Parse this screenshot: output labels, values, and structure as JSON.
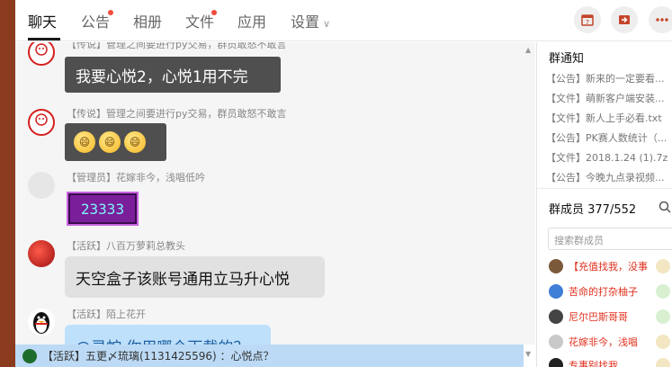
{
  "tabs": [
    {
      "label": "聊天",
      "active": true
    },
    {
      "label": "公告",
      "dot": true
    },
    {
      "label": "相册"
    },
    {
      "label": "文件",
      "dot": true
    },
    {
      "label": "应用"
    },
    {
      "label": "设置"
    }
  ],
  "top_icons": [
    "calendar-icon",
    "forward-icon",
    "more-icon"
  ],
  "messages": [
    {
      "sender": "【传说】管理之间要进行py交易，群员敢怒不敢言",
      "text": "我要心悦2，心悦1用不完"
    },
    {
      "sender": "【传说】管理之间要进行py交易，群员敢怒不敢言",
      "emojis": [
        "😄",
        "😄",
        "😄"
      ]
    },
    {
      "sender": "【管理员】花嫁非今，浅唱低吟",
      "text": "23333"
    },
    {
      "sender": "【活跃】八百万萝莉总教头",
      "text": "天空盒子该账号通用立马升心悦"
    },
    {
      "sender": "【活跃】陌上花开",
      "text": "@灵蛇  你用哪个下载的？"
    }
  ],
  "bottom_notice": "【活跃】五更〆琉璃(1131425596) ：心悦点？",
  "right_panel": {
    "announcements_title": "群通知",
    "announcements": [
      "【公告】新来的一定要看...",
      "【文件】萌新客户端安装...",
      "【文件】新人上手必看.txt",
      "【公告】PK赛人数统计（...",
      "【文件】2018.1.24 (1).7z",
      "【公告】今晚九点录视频..."
    ],
    "members_title": "群成员 377/552",
    "search_placeholder": "搜索群成员",
    "members": [
      {
        "name": "【充值找我，没事",
        "color": "#e0301e"
      },
      {
        "name": "苦命的打杂柚子",
        "color": "#e0301e"
      },
      {
        "name": "尼尔巴斯哥哥",
        "color": "#e0301e"
      },
      {
        "name": "花嫁非今，浅唱",
        "color": "#e0301e"
      },
      {
        "name": "专事别找我",
        "color": "#e0301e"
      }
    ]
  }
}
